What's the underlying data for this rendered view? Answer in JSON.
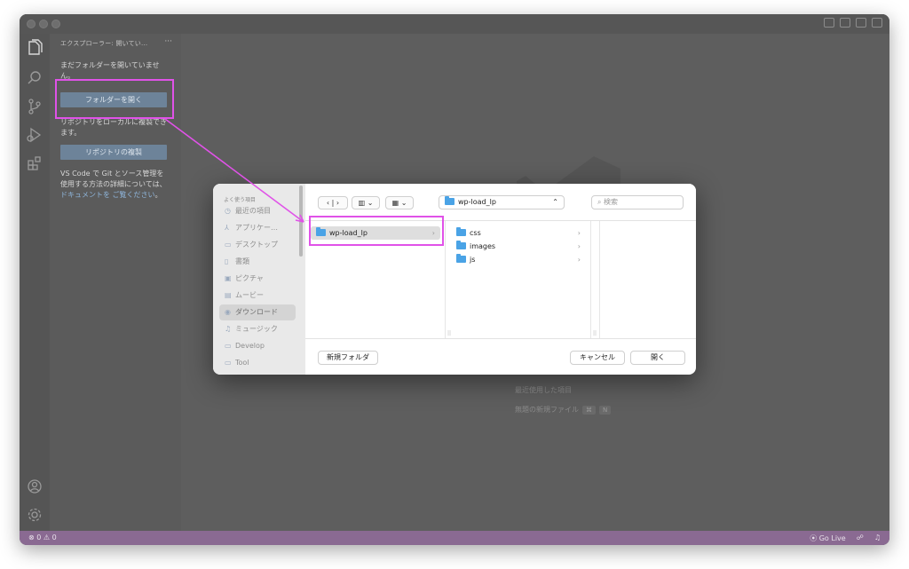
{
  "colors": {
    "accent": "#e052e8",
    "statusbar": "#8a6a92",
    "button": "#6d8399",
    "folder": "#4aa3e6"
  },
  "explorer": {
    "header": "エクスプローラー: 開いてい...",
    "more": "···",
    "no_folder_text": "まだフォルダーを開いていません。",
    "open_folder_button": "フォルダーを開く",
    "clone_text": "リポジトリをローカルに複製できます。",
    "clone_button": "リポジトリの複製",
    "git_text_1": "VS Code で Git とソース管理を使用する方法の詳細については、",
    "git_link": "ドキュメントを ご覧ください",
    "git_text_2": "。"
  },
  "activity_icons": [
    "files-icon",
    "search-icon",
    "source-control-icon",
    "run-debug-icon",
    "extensions-icon",
    "account-icon",
    "settings-gear-icon"
  ],
  "editor": {
    "shortcut_1": "最近使用した項目",
    "shortcut_2": "無題の新規ファイル",
    "shortcut_2_keys": [
      "⌘",
      "N"
    ]
  },
  "status": {
    "errors": "0",
    "warnings": "0",
    "go_live": "Go Live"
  },
  "dialog": {
    "favorites_label": "よく使う項目",
    "sidebar": [
      {
        "icon": "◷",
        "label": "最近の項目"
      },
      {
        "icon": "⅄",
        "label": "アプリケー…"
      },
      {
        "icon": "▭",
        "label": "デスクトップ"
      },
      {
        "icon": "▯",
        "label": "書類"
      },
      {
        "icon": "▣",
        "label": "ピクチャ"
      },
      {
        "icon": "▤",
        "label": "ムービー"
      },
      {
        "icon": "◉",
        "label": "ダウンロード"
      },
      {
        "icon": "♫",
        "label": "ミュージック"
      },
      {
        "icon": "▭",
        "label": "Develop"
      },
      {
        "icon": "▭",
        "label": "Tool"
      }
    ],
    "path": "wp-load_lp",
    "search_placeholder": "検索",
    "column1": [
      "wp-load_lp"
    ],
    "column2": [
      "css",
      "images",
      "js"
    ],
    "new_folder": "新規フォルダ",
    "cancel": "キャンセル",
    "open": "開く"
  }
}
